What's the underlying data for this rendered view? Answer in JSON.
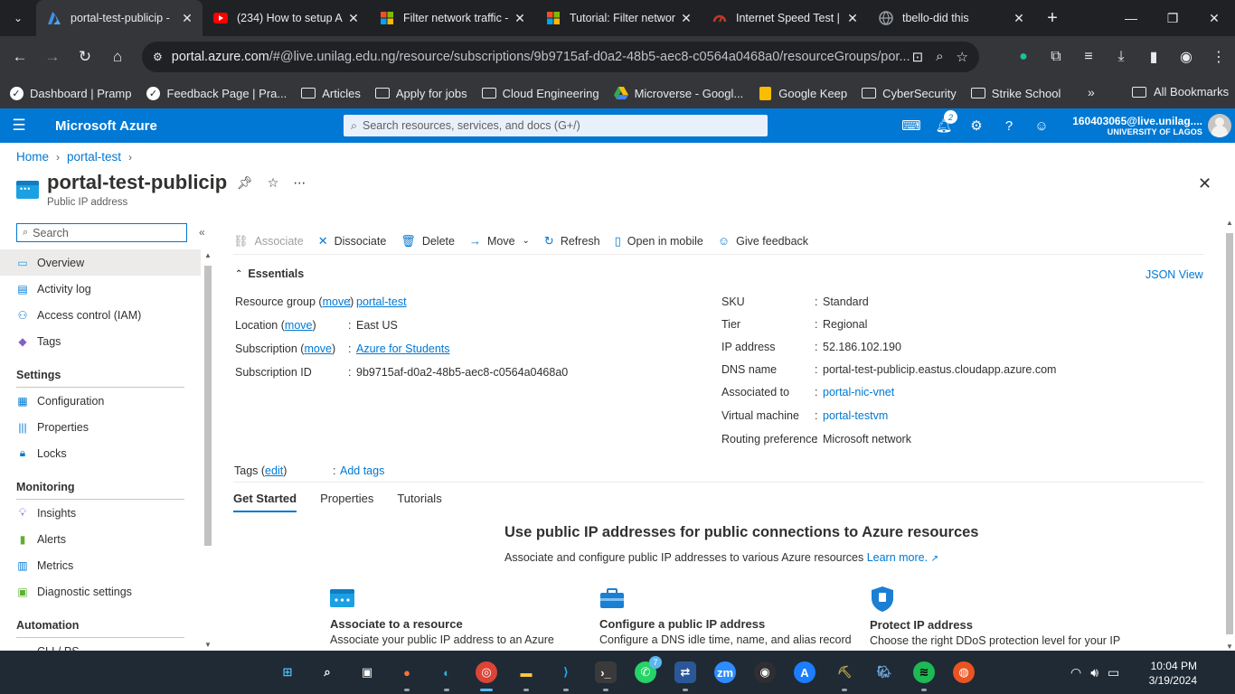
{
  "browser": {
    "tabs": [
      {
        "title": "portal-test-publicip -",
        "icon": "azure-favicon",
        "active": true
      },
      {
        "title": "(234) How to setup A",
        "icon": "youtube-favicon",
        "active": false
      },
      {
        "title": "Filter network traffic -",
        "icon": "microsoft-favicon",
        "active": false
      },
      {
        "title": "Tutorial: Filter networ",
        "icon": "microsoft-favicon",
        "active": false
      },
      {
        "title": "Internet Speed Test |",
        "icon": "speedtest-favicon",
        "active": false
      },
      {
        "title": "tbello-did this",
        "icon": "globe-favicon",
        "active": false
      }
    ],
    "url_host": "portal.azure.com",
    "url_rest": "/#@live.unilag.edu.ng/resource/subscriptions/9b9715af-d0a2-48b5-aec8-c0564a0468a0/resourceGroups/por...",
    "bookmarks": [
      {
        "label": "Dashboard | Pramp",
        "icon": "check-icon"
      },
      {
        "label": "Feedback Page | Pra...",
        "icon": "check-icon"
      },
      {
        "label": "Articles",
        "icon": "folder-icon"
      },
      {
        "label": "Apply for jobs",
        "icon": "folder-icon"
      },
      {
        "label": "Cloud Engineering",
        "icon": "folder-icon"
      },
      {
        "label": "Microverse - Googl...",
        "icon": "drive-icon"
      },
      {
        "label": "Google Keep",
        "icon": "keep-icon"
      },
      {
        "label": "CyberSecurity",
        "icon": "folder-icon"
      },
      {
        "label": "Strike School",
        "icon": "folder-icon"
      }
    ],
    "all_bookmarks": "All Bookmarks"
  },
  "azure": {
    "brand": "Microsoft Azure",
    "search_placeholder": "Search resources, services, and docs (G+/)",
    "notification_count": "2",
    "account_email": "160403065@live.unilag....",
    "account_org": "UNIVERSITY OF LAGOS"
  },
  "breadcrumb": [
    "Home",
    "portal-test"
  ],
  "resource": {
    "name": "portal-test-publicip",
    "type": "Public IP address"
  },
  "menu": {
    "search_placeholder": "Search",
    "top": [
      {
        "label": "Overview",
        "icon": "overview-icon"
      },
      {
        "label": "Activity log",
        "icon": "activity-log-icon"
      },
      {
        "label": "Access control (IAM)",
        "icon": "iam-icon"
      },
      {
        "label": "Tags",
        "icon": "tag-icon"
      }
    ],
    "settings_header": "Settings",
    "settings": [
      {
        "label": "Configuration",
        "icon": "configuration-icon"
      },
      {
        "label": "Properties",
        "icon": "properties-icon"
      },
      {
        "label": "Locks",
        "icon": "lock-icon"
      }
    ],
    "monitoring_header": "Monitoring",
    "monitoring": [
      {
        "label": "Insights",
        "icon": "insights-icon"
      },
      {
        "label": "Alerts",
        "icon": "alerts-icon"
      },
      {
        "label": "Metrics",
        "icon": "metrics-icon"
      },
      {
        "label": "Diagnostic settings",
        "icon": "diagnostic-icon"
      }
    ],
    "automation_header": "Automation",
    "automation": [
      {
        "label": "CLI / PS",
        "icon": "cli-icon"
      }
    ]
  },
  "commands": {
    "associate": "Associate",
    "dissociate": "Dissociate",
    "delete": "Delete",
    "move": "Move",
    "refresh": "Refresh",
    "open_mobile": "Open in mobile",
    "feedback": "Give feedback"
  },
  "essentials": {
    "header": "Essentials",
    "json_view": "JSON View",
    "left": {
      "rg_label": "Resource group",
      "move": "move",
      "rg_value": "portal-test",
      "location_label": "Location",
      "location_value": "East US",
      "subscription_label": "Subscription",
      "subscription_value": "Azure for Students",
      "subid_label": "Subscription ID",
      "subid_value": "9b9715af-d0a2-48b5-aec8-c0564a0468a0"
    },
    "right": [
      {
        "label": "SKU",
        "value": "Standard",
        "link": false
      },
      {
        "label": "Tier",
        "value": "Regional",
        "link": false
      },
      {
        "label": "IP address",
        "value": "52.186.102.190",
        "link": false
      },
      {
        "label": "DNS name",
        "value": "portal-test-publicip.eastus.cloudapp.azure.com",
        "link": false
      },
      {
        "label": "Associated to",
        "value": "portal-nic-vnet",
        "link": true
      },
      {
        "label": "Virtual machine",
        "value": "portal-testvm",
        "link": true
      },
      {
        "label": "Routing preference",
        "value": "Microsoft network",
        "link": false
      }
    ],
    "tags_label": "Tags",
    "tags_edit": "edit",
    "add_tags": "Add tags"
  },
  "content_tabs": [
    "Get Started",
    "Properties",
    "Tutorials"
  ],
  "get_started": {
    "title": "Use public IP addresses for public connections to Azure resources",
    "subtitle": "Associate and configure public IP addresses to various Azure resources",
    "learn_more": "Learn more.",
    "cards": [
      {
        "title": "Associate to a resource",
        "desc": "Associate your public IP address to an Azure",
        "icon": "public-ip-icon"
      },
      {
        "title": "Configure a public IP address",
        "desc": "Configure a DNS idle time, name, and alias record",
        "icon": "toolbox-icon"
      },
      {
        "title": "Protect IP address",
        "desc": "Choose the right DDoS protection level for your IP",
        "icon": "shield-icon"
      }
    ]
  },
  "taskbar": {
    "apps": [
      "start",
      "search",
      "task-view",
      "firefox",
      "edge",
      "chrome",
      "file-explorer",
      "vscode",
      "terminal",
      "whatsapp",
      "rdp",
      "zoom",
      "obs",
      "app-store",
      "shovel",
      "postgres",
      "spotify",
      "ubuntu-app"
    ],
    "whatsapp_badge": "7",
    "time": "10:04 PM",
    "date": "3/19/2024"
  }
}
